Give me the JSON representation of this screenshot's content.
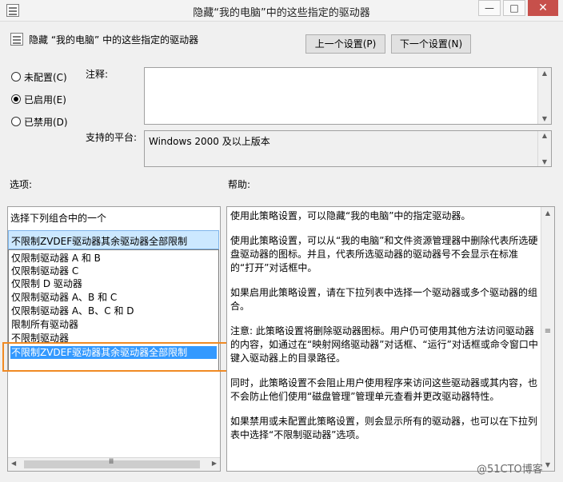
{
  "window": {
    "title": "隐藏“我的电脑”中的这些指定的驱动器",
    "minimize": "—",
    "maximize": "□",
    "close": "✕"
  },
  "header": {
    "policy_name": "隐藏 “我的电脑” 中的这些指定的驱动器",
    "prev_button": "上一个设置(P)",
    "next_button": "下一个设置(N)"
  },
  "state": {
    "options": [
      {
        "label": "未配置(C)",
        "checked": false
      },
      {
        "label": "已启用(E)",
        "checked": true
      },
      {
        "label": "已禁用(D)",
        "checked": false
      }
    ]
  },
  "comment": {
    "label": "注释:",
    "value": ""
  },
  "platform": {
    "label": "支持的平台:",
    "value": "Windows 2000 及以上版本"
  },
  "options_panel": {
    "label": "选项:",
    "prompt": "选择下列组合中的一个",
    "combo_value": "不限制ZVDEF驱动器其余驱动器全部限制",
    "items": [
      "仅限制驱动器 A 和 B",
      "仅限制驱动器 C",
      "仅限制 D 驱动器",
      "仅限制驱动器 A、B 和 C",
      "仅限制驱动器 A、B、C 和 D",
      "限制所有驱动器",
      "不限制驱动器",
      "不限制ZVDEF驱动器其余驱动器全部限制"
    ],
    "selected_index": 7
  },
  "help_panel": {
    "label": "帮助:",
    "paragraphs": [
      "使用此策略设置，可以隐藏“我的电脑”中的指定驱动器。",
      "使用此策略设置，可以从“我的电脑”和文件资源管理器中删除代表所选硬盘驱动器的图标。并且，代表所选驱动器的驱动器号不会显示在标准的“打开”对话框中。",
      "如果启用此策略设置，请在下拉列表中选择一个驱动器或多个驱动器的组合。",
      "注意: 此策略设置将删除驱动器图标。用户仍可使用其他方法访问驱动器的内容，如通过在“映射网络驱动器”对话框、“运行”对话框或命令窗口中键入驱动器上的目录路径。",
      "同时，此策略设置不会阻止用户使用程序来访问这些驱动器或其内容，也不会防止他们使用“磁盘管理”管理单元查看并更改驱动器特性。",
      "如果禁用或未配置此策略设置，则会显示所有的驱动器，也可以在下拉列表中选择“不限制驱动器”选项。"
    ]
  },
  "watermark": "@51CTO博客"
}
